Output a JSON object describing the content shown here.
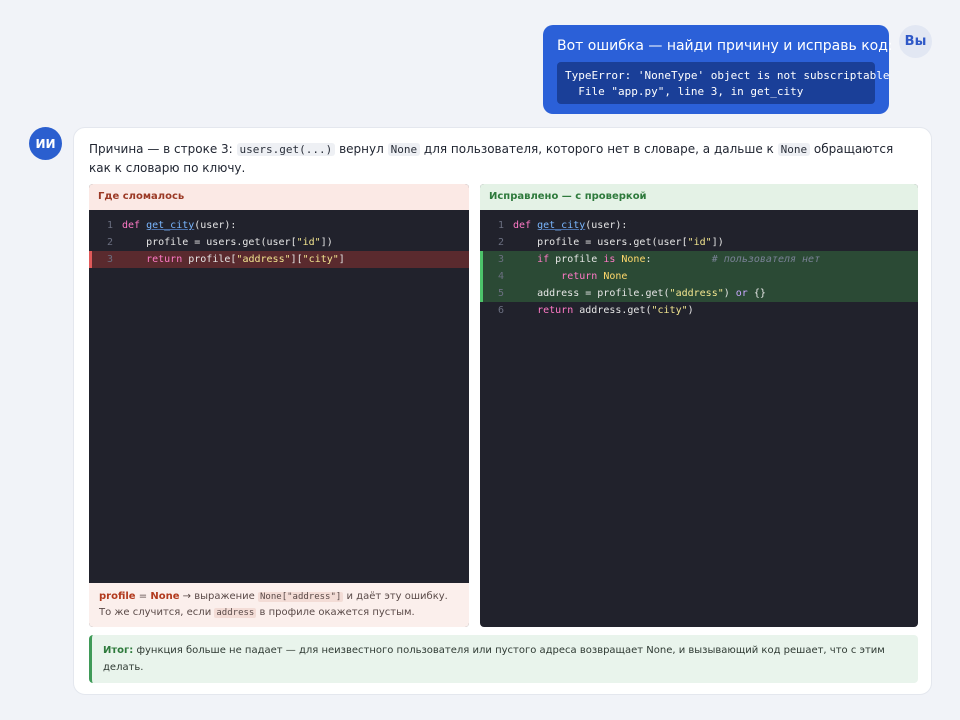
{
  "user": {
    "avatar": "Вы",
    "message": "Вот ошибка — найди причину и исправь код:",
    "error_line1": "TypeError: 'NoneType' object is not subscriptable",
    "error_line2": "  File \"app.py\", line 3, in get_city"
  },
  "ai": {
    "avatar": "ИИ",
    "intro": {
      "p1": "Причина — в строке 3: ",
      "c1": "users.get(...)",
      "p2": " вернул ",
      "c2": "None",
      "p3": " для пользователя, которого нет в словаре, а дальше к ",
      "c3": "None",
      "p4": " обращаются как к словарю по ключу."
    },
    "broken_panel": {
      "title": "Где сломалось",
      "lines": [
        {
          "n": "1",
          "text": "def get_city(user):"
        },
        {
          "n": "2",
          "text": "    profile = users.get(user[\"id\"])"
        },
        {
          "n": "3",
          "text": "    return profile[\"address\"][\"city\"]"
        }
      ],
      "note": {
        "h1": "profile",
        "eq": " = ",
        "h2": "None",
        "t1": " → выражение ",
        "c1": "None[\"address\"]",
        "t2": " и даёт эту ошибку. То же случится, если ",
        "c2": "address",
        "t3": " в профиле окажется пустым."
      }
    },
    "fixed_panel": {
      "title": "Исправлено — с проверкой",
      "lines": [
        {
          "n": "1",
          "text": "def get_city(user):"
        },
        {
          "n": "2",
          "text": "    profile = users.get(user[\"id\"])"
        },
        {
          "n": "3",
          "text": "    if profile is None:",
          "comment": "# пользователя нет"
        },
        {
          "n": "4",
          "text": "        return None"
        },
        {
          "n": "5",
          "text": "    address = profile.get(\"address\") or {}"
        },
        {
          "n": "6",
          "text": "    return address.get(\"city\")"
        }
      ]
    },
    "summary": {
      "label": "Итог:",
      "text": " функция больше не падает — для неизвестного пользователя или пустого адреса возвращает None, и вызывающий код решает, что с этим делать."
    }
  }
}
